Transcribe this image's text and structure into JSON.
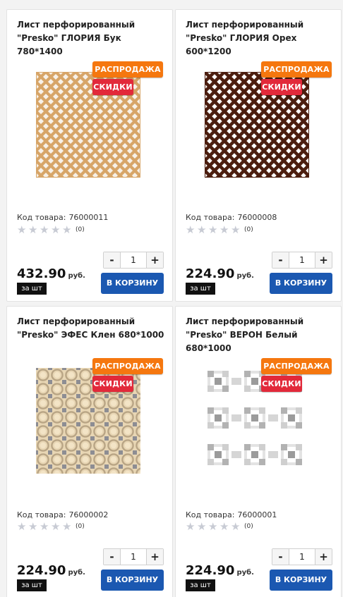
{
  "badges": {
    "sale": "РАСПРОДАЖА",
    "discount": "СКИДКИ"
  },
  "labels": {
    "code_prefix": "Код товара:",
    "currency": "руб.",
    "unit": "за шт",
    "cart_button": "В КОРЗИНУ",
    "minus": "-",
    "plus": "+"
  },
  "colors": {
    "sale_badge": "#f5770f",
    "discount_badge": "#e2293a",
    "cart_button": "#1b58b1",
    "star_empty": "#c8cbd4"
  },
  "products": [
    {
      "title": "Лист перфорированный \"Presko\" ГЛОРИЯ Бук 780*1400",
      "code": "76000011",
      "rating": 0,
      "reviews": "(0)",
      "price": "432.90",
      "quantity": "1",
      "image": "lattice-beech"
    },
    {
      "title": "Лист перфорированный \"Presko\" ГЛОРИЯ Орех 600*1200",
      "code": "76000008",
      "rating": 0,
      "reviews": "(0)",
      "price": "224.90",
      "quantity": "1",
      "image": "lattice-walnut"
    },
    {
      "title": "Лист перфорированный \"Presko\" ЭФЕС Клен 680*1000",
      "code": "76000002",
      "rating": 0,
      "reviews": "(0)",
      "price": "224.90",
      "quantity": "1",
      "image": "circles-maple"
    },
    {
      "title": "Лист перфорированный \"Presko\" ВЕРОН Белый 680*1000",
      "code": "76000001",
      "rating": 0,
      "reviews": "(0)",
      "price": "224.90",
      "quantity": "1",
      "image": "squares-white"
    }
  ]
}
